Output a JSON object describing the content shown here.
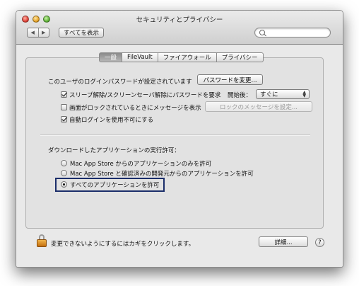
{
  "window": {
    "title": "セキュリティとプライバシー",
    "show_all_label": "すべてを表示",
    "search_placeholder": ""
  },
  "tabs": [
    {
      "label": "一般",
      "active": true
    },
    {
      "label": "FileVault",
      "active": false
    },
    {
      "label": "ファイアウォール",
      "active": false
    },
    {
      "label": "プライバシー",
      "active": false
    }
  ],
  "general": {
    "password_set_label": "このユーザのログインパスワードが設定されています",
    "change_password_button": "パスワードを変更...",
    "require_password": {
      "label": "スリープ解除/スクリーンセーバ解除にパスワードを要求",
      "checked": true
    },
    "start_after_label": "開始後：",
    "start_after_value": "すぐに",
    "show_message": {
      "label": "画面がロックされているときにメッセージを表示",
      "checked": false
    },
    "set_lock_message_button": "ロックのメッセージを設定...",
    "disable_auto_login": {
      "label": "自動ログインを使用不可にする",
      "checked": true
    }
  },
  "downloads": {
    "heading": "ダウンロードしたアプリケーションの実行許可：",
    "options": [
      {
        "label": "Mac App Store からのアプリケーションのみを許可",
        "selected": false
      },
      {
        "label": "Mac App Store と確認済みの開発元からのアプリケーションを許可",
        "selected": false
      },
      {
        "label": "すべてのアプリケーションを許可",
        "selected": true
      }
    ]
  },
  "footer": {
    "lock_text": "変更できないようにするにはカギをクリックします。",
    "advanced_button": "詳細...",
    "help_label": "?"
  },
  "colors": {
    "highlight_border": "#1b2e6a",
    "lock_orange": "#e59a2a"
  }
}
